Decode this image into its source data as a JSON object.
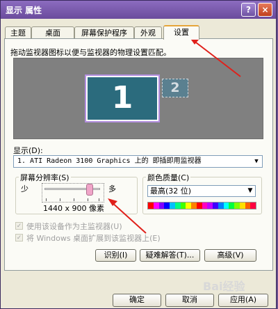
{
  "window": {
    "title": "显示 属性",
    "help_btn": "?",
    "close_btn": "×"
  },
  "tabs": [
    {
      "label": "主题"
    },
    {
      "label": "桌面"
    },
    {
      "label": "屏幕保护程序"
    },
    {
      "label": "外观"
    },
    {
      "label": "设置"
    }
  ],
  "settings": {
    "description": "拖动监视器图标以便与监视器的物理设置匹配。",
    "monitor1": "1",
    "monitor2": "2",
    "display_label": "显示(D):",
    "display_value": "1. ATI Radeon 3100 Graphics 上的 即插即用监视器",
    "resolution": {
      "label": "屏幕分辨率(S)",
      "less": "少",
      "more": "多",
      "value": "1440 x 900 像素",
      "slider_fraction": 0.85
    },
    "color_quality": {
      "label": "颜色质量(C)",
      "value": "最高(32 位)"
    },
    "checkbox_primary": "使用该设备作为主监视器(U)",
    "checkbox_extend": "将 Windows 桌面扩展到该监视器上(E)",
    "buttons": {
      "identify": "识别(I)",
      "troubleshoot": "疑难解答(T)...",
      "advanced": "高级(V)"
    }
  },
  "footer": {
    "ok": "确定",
    "cancel": "取消",
    "apply": "应用(A)"
  },
  "watermark": "Bai经验",
  "colors": {
    "accent_tab": "#e6a53a",
    "arrow": "#e0201a",
    "monitor_fill": "#2b6b7d",
    "titlebar": "#7a5aae"
  }
}
